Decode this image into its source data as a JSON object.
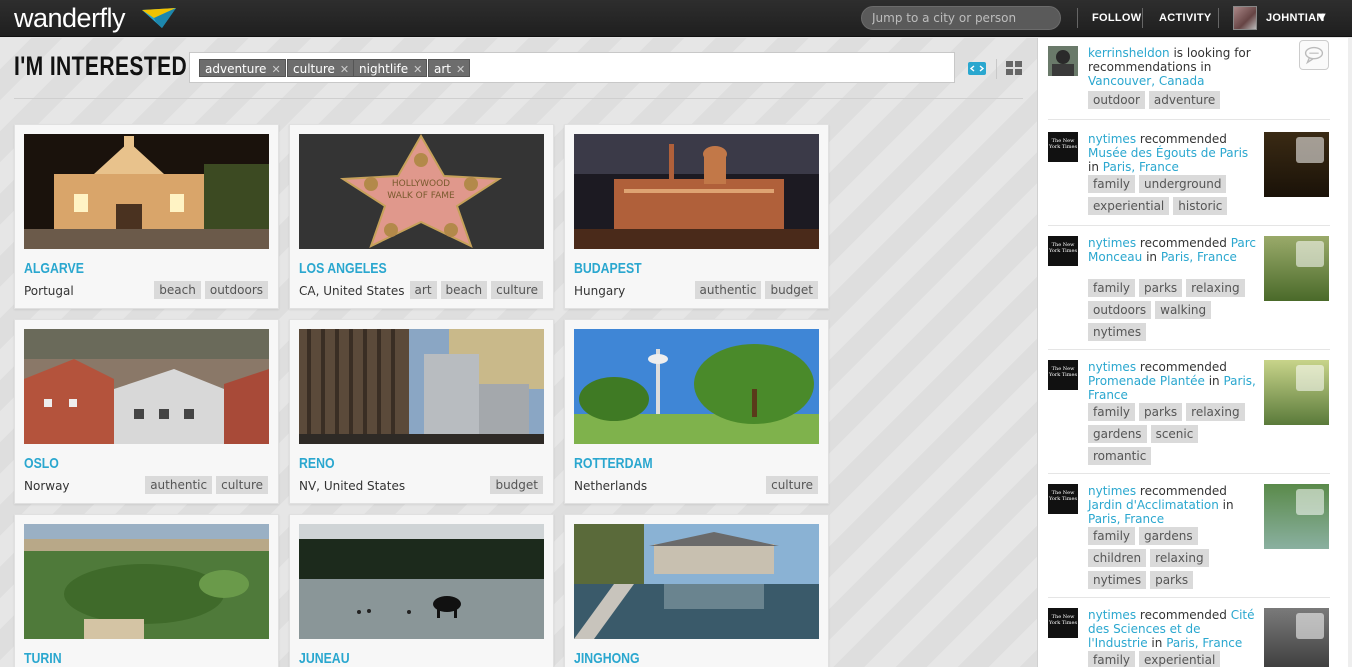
{
  "app": {
    "logo_text": "wanderfly"
  },
  "header": {
    "search_placeholder": "Jump to a city or person",
    "nav": [
      {
        "label": "FOLLOW"
      },
      {
        "label": "ACTIVITY"
      }
    ],
    "user": {
      "name": "JOHNTIAN"
    }
  },
  "filter": {
    "title": "I'M INTERESTED IN",
    "chips": [
      {
        "label": "adventure"
      },
      {
        "label": "culture"
      },
      {
        "label": "nightlife"
      },
      {
        "label": "art"
      }
    ]
  },
  "cards": [
    {
      "city": "ALGARVE",
      "country": "Portugal",
      "tags": [
        "beach",
        "outdoors"
      ]
    },
    {
      "city": "LOS ANGELES",
      "country": "CA, United States",
      "tags": [
        "art",
        "beach",
        "culture"
      ],
      "photo_text": "HOLLYWOOD WALK OF FAME"
    },
    {
      "city": "BUDAPEST",
      "country": "Hungary",
      "tags": [
        "authentic",
        "budget"
      ]
    },
    {
      "city": "OSLO",
      "country": "Norway",
      "tags": [
        "authentic",
        "culture"
      ]
    },
    {
      "city": "RENO",
      "country": "NV, United States",
      "tags": [
        "budget"
      ]
    },
    {
      "city": "ROTTERDAM",
      "country": "Netherlands",
      "tags": [
        "culture"
      ]
    },
    {
      "city": "TURIN",
      "country": "",
      "tags": []
    },
    {
      "city": "JUNEAU",
      "country": "",
      "tags": []
    },
    {
      "city": "JINGHONG",
      "country": "",
      "tags": []
    }
  ],
  "feed": [
    {
      "user": "kerrinsheldon",
      "action": " is looking for recommendations in ",
      "place": "",
      "location": "Vancouver, Canada",
      "tags": [
        "outdoor",
        "adventure"
      ]
    },
    {
      "user": "nytimes",
      "action": " recommended ",
      "place": "Musée des Égouts de Paris",
      "location": "Paris, France",
      "tags": [
        "family",
        "underground",
        "experiential",
        "historic"
      ]
    },
    {
      "user": "nytimes",
      "action": " recommended ",
      "place": "Parc Monceau",
      "location": "Paris, France",
      "tags": [
        "family",
        "parks",
        "relaxing",
        "outdoors",
        "walking",
        "nytimes"
      ]
    },
    {
      "user": "nytimes",
      "action": " recommended ",
      "place": "Promenade Plantée",
      "location": "Paris, France",
      "tags": [
        "family",
        "parks",
        "relaxing",
        "gardens",
        "scenic",
        "romantic"
      ]
    },
    {
      "user": "nytimes",
      "action": " recommended ",
      "place": "Jardin d'Acclimatation",
      "location": "Paris, France",
      "tags": [
        "family",
        "gardens",
        "children",
        "relaxing",
        "nytimes",
        "parks"
      ]
    },
    {
      "user": "nytimes",
      "action": " recommended ",
      "place": "Cité des Sciences et de l'Industrie",
      "location": "Paris, France",
      "tags": [
        "family",
        "experiential"
      ]
    }
  ],
  "connector_in": " in ",
  "logo_badge_text": "The New York Times",
  "colors": {
    "accent": "#2aa7cf",
    "topbar": "#262626",
    "chip": "#6d6d6d",
    "tag_bg": "#dadada"
  }
}
